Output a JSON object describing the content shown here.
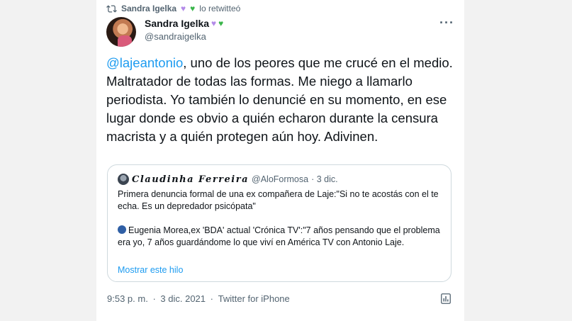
{
  "retweet": {
    "user": "Sandra Igelka",
    "suffix": "lo retwitteó"
  },
  "tweet": {
    "display_name": "Sandra Igelka",
    "handle": "@sandraigelka",
    "mention": "@lajeantonio",
    "text": ", uno de los peores que me crucé en el medio. Maltratador de todas las formas. Me niego a llamarlo periodista. Yo también lo denuncié en su momento, en ese lugar donde es obvio a quién echaron durante la censura macrista y a quién protegen aún hoy. Adivinen.",
    "time": "9:53 p. m.",
    "date": "3 dic. 2021",
    "source": "Twitter for iPhone",
    "separator": "·"
  },
  "quote": {
    "name": "Claudinha Ferreira",
    "handle": "@AloFormosa",
    "date": "· 3 dic.",
    "paragraph1": "Primera denuncia formal de una ex compañera de Laje:\"Si no te acostás con el te echa. Es un depredador psicópata\"",
    "paragraph2": "Eugenia Morea,ex 'BDA' actual 'Crónica TV':\"7 años pensando que el problema era yo, 7 años guardándome lo que viví en América TV con Antonio Laje.",
    "show_thread": "Mostrar este hilo"
  },
  "icons": {
    "retweet": "retweet-icon",
    "more": "more-icon",
    "analytics": "analytics-icon"
  },
  "colors": {
    "link": "#1d9bf0",
    "secondary": "#536471",
    "heart_purple": "#b38ae8",
    "heart_green": "#39b54a"
  }
}
